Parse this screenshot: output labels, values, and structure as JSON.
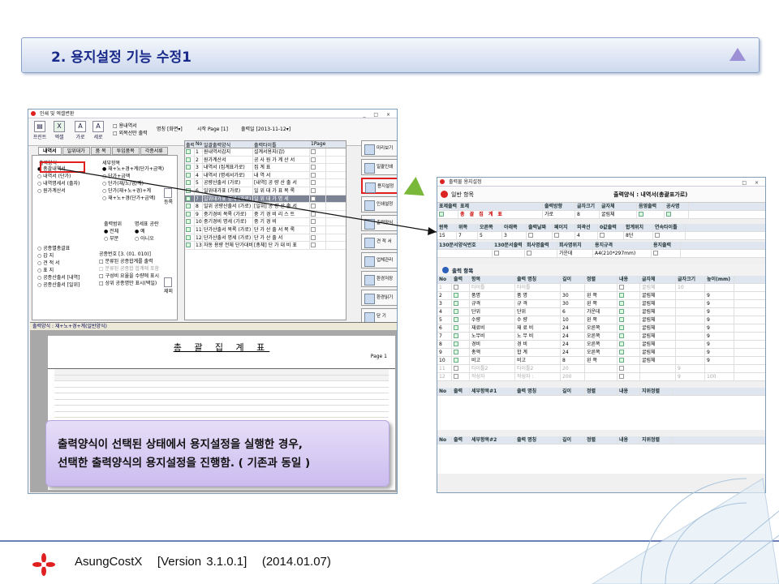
{
  "banner": {
    "title": "2. 용지설정 기능 수정1"
  },
  "window1": {
    "title": "인쇄 및 엑셀변환",
    "toolbar": {
      "print": "프린트",
      "excel": "엑셀",
      "landscape": "가로",
      "portrait": "세로",
      "opt1": "용내역서",
      "opt2": "외목선만 출력",
      "copies_label": "명칭",
      "copies_value": "화면",
      "start_page_label": "시작 Page",
      "start_page": "1",
      "date_label": "출력일",
      "date_value": "2013-11-12"
    },
    "tabs": [
      "내역서",
      "일위대가",
      "품 목",
      "투입품목",
      "각종서류"
    ],
    "left": {
      "group1_title": "출력양식",
      "group1_items": [
        "총괄내역서",
        "내역서 (단가)",
        "내역명세서 (출자)",
        "원가계산서"
      ],
      "group2_title": "세부항목",
      "group2_items": [
        "재+노+경+계(단가+금액)",
        "단가+금액",
        "단가(재/노/경/계)",
        "단가(재+노+경)+계",
        "재+노+경(단가+금액)"
      ],
      "group3_items": [
        "공종별총괄표",
        "갑 지",
        "견 적 서",
        "표 지",
        "공종산출서 [내역]",
        "공종산출서 [일위]"
      ],
      "range_label": "출력범위",
      "range_all": "전체",
      "range_part": "부분",
      "empty_label": "명세표 공란",
      "empty_yes": "예",
      "empty_no": "아니오",
      "code_label": "공종번호",
      "code_value": "[3. (01. 010)]",
      "check_items": [
        "분류된 공종합계를 출력",
        "분류된 공종합 합계에 포함",
        "구성비 요율을 수량에 표시",
        "상위 공종명만 표시(택일)"
      ],
      "side_buttons": [
        "등록",
        "제외"
      ]
    },
    "grid_headers": [
      "출력",
      "No",
      "일괄출력양식",
      "출력타이틀",
      "1Page"
    ],
    "grid_rows": [
      {
        "no": "1",
        "form": "원내역서갑지",
        "title": "설계서용지(갑)"
      },
      {
        "no": "2",
        "form": "원가계산서",
        "title": "공 사 원 가 계 산 서"
      },
      {
        "no": "3",
        "form": "내역서 (집계표가로)",
        "title": "집 계 표"
      },
      {
        "no": "4",
        "form": "내역서 (명세서가로)",
        "title": "내 역 서"
      },
      {
        "no": "5",
        "form": "공량산출서 (가로)",
        "title": "[내역] 공 량 산 출 서"
      },
      {
        "no": "6",
        "form": "일위대가표 (가로)",
        "title": "일 위 대 가 표 목 록"
      },
      {
        "no": "7",
        "form": "일위대가표 명세 (가로)",
        "title": "일 위 대 가 명 세"
      },
      {
        "no": "8",
        "form": "일위 공량산출서 (가로)",
        "title": "[일위] 공 량 산 출 서"
      },
      {
        "no": "9",
        "form": "중기경비 목록 (가로)",
        "title": "중 기 경 비 리 스 트"
      },
      {
        "no": "10",
        "form": "중기경비 명세 (가로)",
        "title": "중 기 경 비"
      },
      {
        "no": "11",
        "form": "단가산출서 목록 (가로)",
        "title": "단 가 산 출 서 목 록"
      },
      {
        "no": "12",
        "form": "단가산출서 명세 (가로)",
        "title": "단 가 산 출 서"
      },
      {
        "no": "13",
        "form": "자동 용량 전체 단가대비표",
        "title": "[총체] 단 가 대 비 표"
      }
    ],
    "right_buttons": [
      "미리보기",
      "일괄인쇄",
      "용지설정 ▾",
      "인쇄설정",
      "출력양식",
      "견 적 서",
      "업체관리",
      "환경저장",
      "환경읽기",
      "닫 기",
      "화면옵겨"
    ],
    "preview": {
      "bar": "출력양식 : 재+노+경+계(일반양식)",
      "paper_title": "총 괄 집 계 표",
      "page_label": "Page",
      "page_no": "1"
    }
  },
  "callout": {
    "line1": "출력양식이 선택된 상태에서 용지설정을 실행한 경우,",
    "line2": "선택한 출력양식의 용지설정을 진행함. ( 기존과 동일 )"
  },
  "window2": {
    "title": "출력물 용지설정",
    "section1": "일반 항목",
    "form_label": "출력양식 : 내역서(총괄표가로)",
    "row1_headers": [
      "표제출력",
      "표제",
      "출력방향",
      "글자크기",
      "글자체",
      "음영출력",
      "공사명"
    ],
    "row1_values": {
      "title": "총 괄 집 계 표",
      "dir": "가로",
      "size": "8",
      "font": "굴림체"
    },
    "row2_headers": [
      "윈쪽",
      "위쪽",
      "오른쪽",
      "아래쪽",
      "출력날짜",
      "페이지",
      "외곽선",
      "0값출력",
      "합계위치",
      "연속타이틀"
    ],
    "row2_values": [
      "15",
      "7",
      "5",
      "3",
      "",
      "",
      "4",
      "",
      "8단",
      ""
    ],
    "row3_headers": [
      "130문서양식번호",
      "130문서출력",
      "회사명출력",
      "회사명위치",
      "용지규격",
      "용지출력"
    ],
    "row3_values": {
      "pos": "가운데",
      "paper": "A4(210*297mm)"
    },
    "section2": "출력 항목",
    "grid_headers": [
      "No",
      "출력",
      "항목",
      "출력 명칭",
      "길이",
      "정렬",
      "내용",
      "글자체",
      "글자크기",
      "높이(mm)"
    ],
    "grid_rows": [
      {
        "no": "1",
        "item": "타이틀",
        "name": "타이틀",
        "len": "",
        "align": "",
        "font": "굴림체",
        "size": "10",
        "h": "",
        "dis": true
      },
      {
        "no": "2",
        "item": "품명",
        "name": "품 명",
        "len": "30",
        "align": "왼 쪽",
        "font": "굴림체",
        "size": "",
        "h": "9"
      },
      {
        "no": "3",
        "item": "규격",
        "name": "규 격",
        "len": "30",
        "align": "왼 쪽",
        "font": "굴림체",
        "size": "",
        "h": "9"
      },
      {
        "no": "4",
        "item": "단위",
        "name": "단위",
        "len": "6",
        "align": "가운데",
        "font": "굴림체",
        "size": "",
        "h": "9"
      },
      {
        "no": "5",
        "item": "수량",
        "name": "수 량",
        "len": "10",
        "align": "왼 쪽",
        "font": "굴림체",
        "size": "",
        "h": "9"
      },
      {
        "no": "6",
        "item": "재료비",
        "name": "재 료 비",
        "len": "24",
        "align": "오른쪽",
        "font": "굴림체",
        "size": "",
        "h": "9"
      },
      {
        "no": "7",
        "item": "노무비",
        "name": "노 무 비",
        "len": "24",
        "align": "오른쪽",
        "font": "굴림체",
        "size": "",
        "h": "9"
      },
      {
        "no": "8",
        "item": "경비",
        "name": "경 비",
        "len": "24",
        "align": "오른쪽",
        "font": "굴림체",
        "size": "",
        "h": "9"
      },
      {
        "no": "9",
        "item": "총액",
        "name": "합 계",
        "len": "24",
        "align": "오른쪽",
        "font": "굴림체",
        "size": "",
        "h": "9"
      },
      {
        "no": "10",
        "item": "비고",
        "name": "비고",
        "len": "8",
        "align": "왼 쪽",
        "font": "굴림체",
        "size": "",
        "h": "9"
      },
      {
        "no": "11",
        "item": "타이틀2",
        "name": "타이틀2",
        "len": "20",
        "align": "",
        "font": "",
        "size": "9",
        "h": "",
        "dis": true
      },
      {
        "no": "12",
        "item": "작성자",
        "name": "작성자 :",
        "len": "200",
        "align": "",
        "font": "",
        "size": "9",
        "h": "100",
        "dis": true
      }
    ],
    "sub1_headers": [
      "No",
      "출력",
      "세부항목#1",
      "출력 명칭",
      "길이",
      "정렬",
      "내용",
      "지위정렬"
    ],
    "sub2_headers": [
      "No",
      "출력",
      "세부항목#2",
      "출력 명칭",
      "길이",
      "정렬",
      "내용",
      "지위정렬"
    ]
  },
  "footer": {
    "product": "AsungCostX",
    "version": "[Version 3.1.0.1]",
    "date": "(2014.01.07)"
  },
  "colors": {
    "accent_red": "#e02020",
    "banner_text": "#1a2a8a",
    "callout_bg": "#d6cbf3",
    "footer_line": "#6b7fb8"
  }
}
